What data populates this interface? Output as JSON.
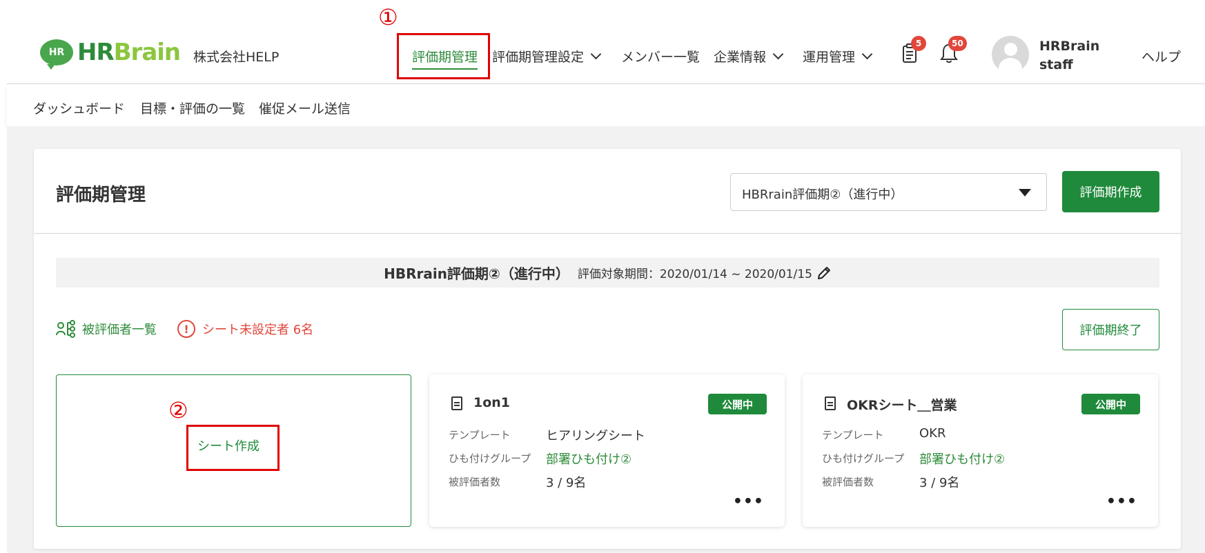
{
  "header": {
    "logo_badge": "HR",
    "logo_hr": "HR",
    "logo_brain": "Brain",
    "company": "株式会社HELP",
    "nav": [
      {
        "label": "評価期管理"
      },
      {
        "label": "評価期管理設定"
      },
      {
        "label": "メンバー一覧"
      },
      {
        "label": "企業情報"
      },
      {
        "label": "運用管理"
      }
    ],
    "clipboard_badge": "5",
    "bell_badge": "50",
    "user_line1": "HRBrain",
    "user_line2": "staff",
    "help": "ヘルプ"
  },
  "subnav": {
    "items": [
      "ダッシュボード",
      "目標・評価の一覧",
      "催促メール送信"
    ]
  },
  "annotations": {
    "one": "①",
    "two": "②"
  },
  "main": {
    "title": "評価期管理",
    "period_select": "HBRrain評価期②（進行中）",
    "create_button": "評価期作成",
    "period_name": "HBRrain評価期②（進行中）",
    "period_range": "評価対象期間：2020/01/14 ~ 2020/01/15",
    "evaluatee_link": "被評価者一覧",
    "warning": "シート未設定者 6名",
    "end_button": "評価期終了",
    "new_sheet": "シート作成",
    "sheets": [
      {
        "name": "1on1",
        "status": "公開中",
        "template_label": "テンプレート",
        "template": "ヒアリングシート",
        "group_label": "ひも付けグループ",
        "group": "部署ひも付け②",
        "count_label": "被評価者数",
        "count": "3 / 9名",
        "more": "•••"
      },
      {
        "name": "OKRシート＿営業",
        "status": "公開中",
        "template_label": "テンプレート",
        "template": "OKR",
        "group_label": "ひも付けグループ",
        "group": "部署ひも付け②",
        "count_label": "被評価者数",
        "count": "3 / 9名",
        "more": "•••"
      }
    ]
  },
  "colors": {
    "primary": "#1f8a3b",
    "warning": "#e2463b",
    "annotation": "#e00000"
  }
}
